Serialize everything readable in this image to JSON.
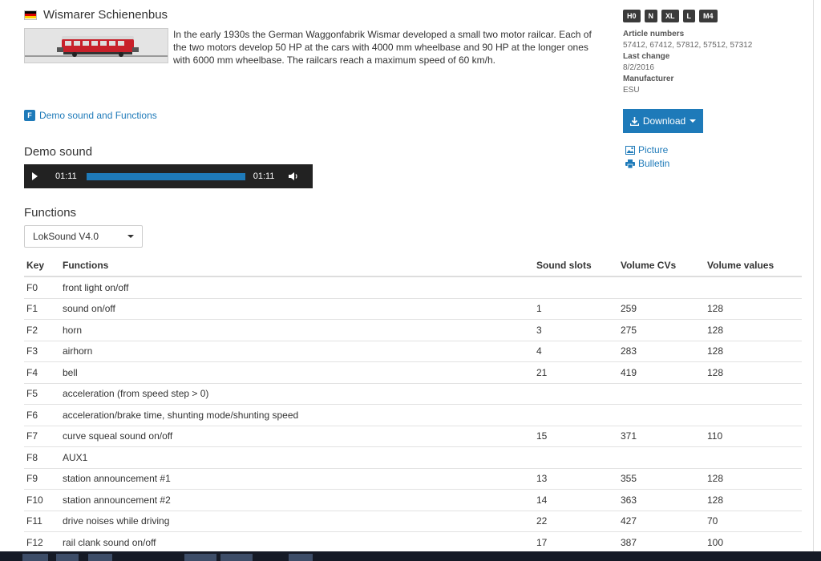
{
  "product": {
    "title": "Wismarer Schienenbus",
    "description": "In the early 1930s the German Waggonfabrik Wismar developed a small two motor railcar. Each of the two motors develop 50 HP at the cars with 4000 mm wheelbase and 90 HP at the longer ones with 6000 mm wheelbase. The railcars reach a maximum speed of 60 km/h.",
    "flag_icon": "german-flag-icon",
    "flag_colors": [
      "#000000",
      "#dd0000",
      "#ffce00"
    ]
  },
  "badges": [
    "H0",
    "N",
    "XL",
    "L",
    "M4"
  ],
  "meta": {
    "article_numbers_label": "Article numbers",
    "article_numbers": "57412, 67412, 57812, 57512, 57312",
    "last_change_label": "Last change",
    "last_change": "8/2/2016",
    "manufacturer_label": "Manufacturer",
    "manufacturer": "ESU"
  },
  "actions": {
    "download_label": "Download",
    "picture_label": "Picture",
    "bulletin_label": "Bulletin"
  },
  "demo_link": {
    "badge": "F",
    "label": "Demo sound and Functions"
  },
  "demo_sound": {
    "heading": "Demo sound",
    "current_time": "01:11",
    "duration": "01:11",
    "progress": 1.0
  },
  "functions": {
    "heading": "Functions",
    "decoder_selected": "LokSound V4.0",
    "columns": [
      "Key",
      "Functions",
      "Sound slots",
      "Volume CVs",
      "Volume values"
    ],
    "rows": [
      [
        "F0",
        "front light on/off",
        "",
        "",
        ""
      ],
      [
        "F1",
        "sound on/off",
        "1",
        "259",
        "128"
      ],
      [
        "F2",
        "horn",
        "3",
        "275",
        "128"
      ],
      [
        "F3",
        "airhorn",
        "4",
        "283",
        "128"
      ],
      [
        "F4",
        "bell",
        "21",
        "419",
        "128"
      ],
      [
        "F5",
        "acceleration (from speed step > 0)",
        "",
        "",
        ""
      ],
      [
        "F6",
        "acceleration/brake time, shunting mode/shunting speed",
        "",
        "",
        ""
      ],
      [
        "F7",
        "curve squeal sound on/off",
        "15",
        "371",
        "110"
      ],
      [
        "F8",
        "AUX1",
        "",
        "",
        ""
      ],
      [
        "F9",
        "station announcement #1",
        "13",
        "355",
        "128"
      ],
      [
        "F10",
        "station announcement #2",
        "14",
        "363",
        "128"
      ],
      [
        "F11",
        "drive noises while driving",
        "22",
        "427",
        "70"
      ],
      [
        "F12",
        "rail clank sound on/off",
        "17",
        "387",
        "100"
      ]
    ]
  },
  "colors": {
    "accent": "#1e7ab9",
    "player_bg": "#222222",
    "badge_bg": "#3a3a3a"
  }
}
